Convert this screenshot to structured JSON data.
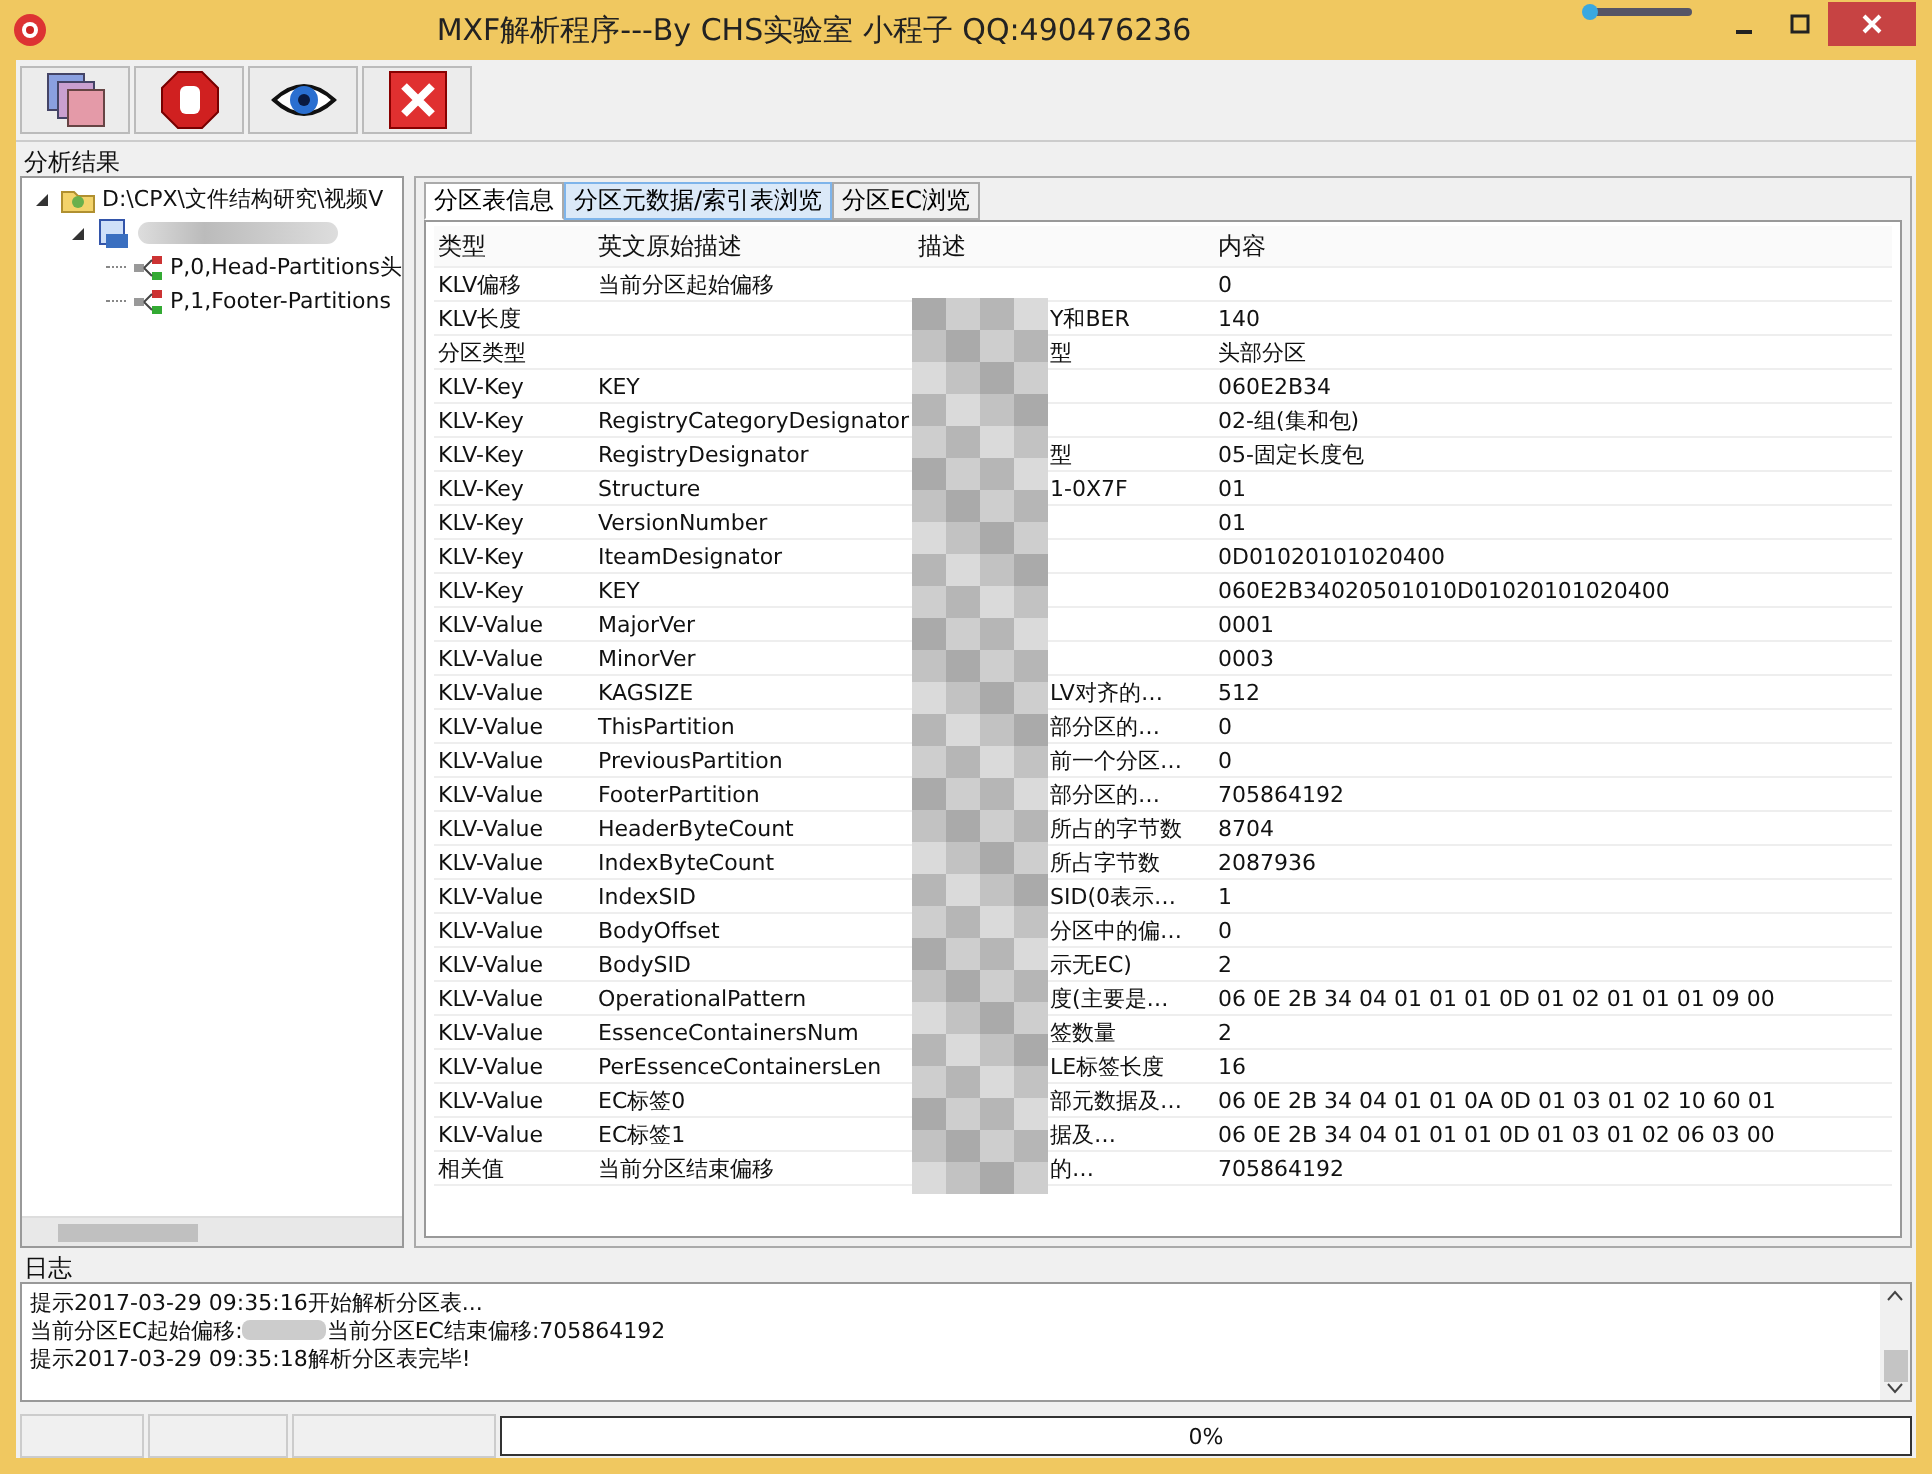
{
  "window": {
    "title": "MXF解析程序---By CHS实验室 小程子 QQ:490476236"
  },
  "toolbar": {
    "buttons": [
      {
        "kind": "film"
      },
      {
        "kind": "stop"
      },
      {
        "kind": "eye"
      },
      {
        "kind": "close"
      }
    ]
  },
  "results_label": "分析结果",
  "tree": {
    "items": [
      {
        "label": "D:\\CPX\\文件结构研究\\视频V",
        "kind": "folder",
        "expanded": true,
        "children": [
          {
            "kind": "file",
            "blurred": true,
            "expanded": true,
            "children": [
              {
                "label": "P,0,Head-Partitions头",
                "kind": "partition"
              },
              {
                "label": "P,1,Footer-Partitions",
                "kind": "partition"
              }
            ]
          }
        ]
      }
    ]
  },
  "tabs": [
    {
      "label": "分区表信息",
      "selected": true,
      "hover": false
    },
    {
      "label": "分区元数据/索引表浏览",
      "selected": false,
      "hover": true
    },
    {
      "label": "分区EC浏览",
      "selected": false,
      "hover": false
    }
  ],
  "table": {
    "columns": [
      "类型",
      "英文原始描述",
      "描述",
      "内容"
    ],
    "rows": [
      [
        "KLV偏移",
        "当前分区起始偏移",
        "",
        "0"
      ],
      [
        "KLV长度",
        "",
        "Y和BER",
        "140"
      ],
      [
        "分区类型",
        "",
        "型",
        "头部分区"
      ],
      [
        "KLV-Key",
        "KEY",
        "",
        "060E2B34"
      ],
      [
        "KLV-Key",
        "RegistryCategoryDesignator",
        "",
        "02-组(集和包)"
      ],
      [
        "KLV-Key",
        "RegistryDesignator",
        "型",
        "05-固定长度包"
      ],
      [
        "KLV-Key",
        "Structure",
        "1-0X7F",
        "01"
      ],
      [
        "KLV-Key",
        "VersionNumber",
        "",
        "01"
      ],
      [
        "KLV-Key",
        "IteamDesignator",
        "",
        "0D01020101020400"
      ],
      [
        "KLV-Key",
        "KEY",
        "",
        "060E2B34020501010D01020101020400"
      ],
      [
        "KLV-Value",
        "MajorVer",
        "",
        "0001"
      ],
      [
        "KLV-Value",
        "MinorVer",
        "",
        "0003"
      ],
      [
        "KLV-Value",
        "KAGSIZE",
        "LV对齐的…",
        "512"
      ],
      [
        "KLV-Value",
        "ThisPartition",
        "部分区的…",
        "0"
      ],
      [
        "KLV-Value",
        "PreviousPartition",
        "前一个分区…",
        "0"
      ],
      [
        "KLV-Value",
        "FooterPartition",
        "部分区的…",
        "705864192"
      ],
      [
        "KLV-Value",
        "HeaderByteCount",
        "所占的字节数",
        "8704"
      ],
      [
        "KLV-Value",
        "IndexByteCount",
        "所占字节数",
        "2087936"
      ],
      [
        "KLV-Value",
        "IndexSID",
        "SID(0表示…",
        "1"
      ],
      [
        "KLV-Value",
        "BodyOffset",
        "分区中的偏…",
        "0"
      ],
      [
        "KLV-Value",
        "BodySID",
        "示无EC)",
        "2"
      ],
      [
        "KLV-Value",
        "OperationalPattern",
        "度(主要是…",
        " 06 0E 2B 34 04 01 01 01 0D 01 02 01 01 01 09 00"
      ],
      [
        "KLV-Value",
        "EssenceContainersNum",
        "签数量",
        "2"
      ],
      [
        "KLV-Value",
        "PerEssenceContainersLen",
        "LE标签长度",
        "16"
      ],
      [
        "KLV-Value",
        "EC标签0",
        "部元数据及…",
        " 06 0E 2B 34 04 01 01 0A 0D 01 03 01 02 10 60 01"
      ],
      [
        "KLV-Value",
        "EC标签1",
        "据及…",
        " 06 0E 2B 34 04 01 01 01 0D 01 03 01 02 06 03 00"
      ],
      [
        "相关值",
        "当前分区结束偏移",
        "的…",
        "705864192"
      ]
    ]
  },
  "log": {
    "label": "日志",
    "lines": [
      {
        "parts": [
          "提示2017-03-29 09:35:16开始解析分区表..."
        ]
      },
      {
        "parts": [
          "当前分区EC起始偏移:",
          "当前分区EC结束偏移:705864192"
        ]
      },
      {
        "parts": [
          "提示2017-03-29 09:35:18解析分区表完毕!"
        ]
      }
    ]
  },
  "status_bar": {
    "progress": {
      "level": 0,
      "text": "0%"
    }
  }
}
